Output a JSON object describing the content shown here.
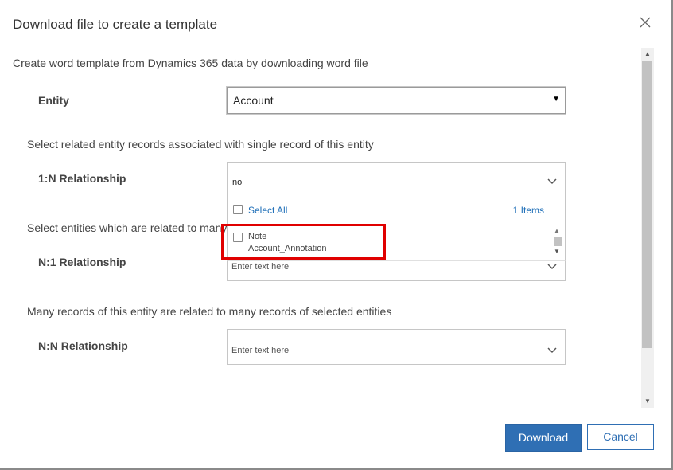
{
  "dialog": {
    "title": "Download file to create a template",
    "intro": "Create word template from Dynamics 365 data by downloading word file"
  },
  "entity": {
    "label": "Entity",
    "value": "Account"
  },
  "one_to_many": {
    "description": "Select related entity records associated with single record of this entity",
    "label": "1:N Relationship",
    "value": "no",
    "dropdown": {
      "select_all": "Select All",
      "count": "1 Items",
      "items": [
        {
          "name": "Note",
          "relationship": "Account_Annotation",
          "checked": false
        }
      ]
    }
  },
  "many_to_one": {
    "description": "Select entities which are related to many",
    "label": "N:1 Relationship",
    "placeholder": "Enter text here"
  },
  "many_to_many": {
    "description": "Many records of this entity are related to many records of selected entities",
    "label": "N:N Relationship",
    "placeholder": "Enter text here"
  },
  "footer": {
    "download": "Download",
    "cancel": "Cancel"
  },
  "colors": {
    "primary": "#2f6fb4",
    "link": "#1f6fb8",
    "highlight": "#e00000"
  },
  "icons": {
    "close": "close-icon",
    "dropdown_arrow": "chevron-down-icon"
  }
}
